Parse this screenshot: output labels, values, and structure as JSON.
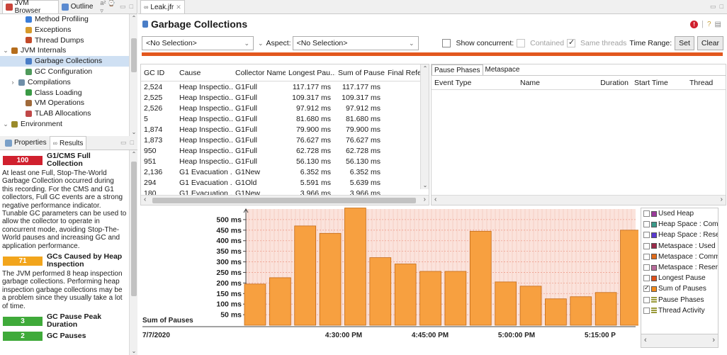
{
  "left_tabs": [
    {
      "label": "JVM Browser"
    },
    {
      "label": "Outline"
    }
  ],
  "tree": [
    {
      "label": "Method Profiling",
      "indent": 2,
      "icon_color": "#3b7dd8",
      "selected": false,
      "twisty": ""
    },
    {
      "label": "Exceptions",
      "indent": 2,
      "icon_color": "#d79a2b",
      "selected": false,
      "twisty": ""
    },
    {
      "label": "Thread Dumps",
      "indent": 2,
      "icon_color": "#c24a2a",
      "selected": false,
      "twisty": ""
    },
    {
      "label": "JVM Internals",
      "indent": 0,
      "icon_color": "#b56d1c",
      "selected": false,
      "twisty": "⌄"
    },
    {
      "label": "Garbage Collections",
      "indent": 2,
      "icon_color": "#4a7ec7",
      "selected": true,
      "twisty": ""
    },
    {
      "label": "GC Configuration",
      "indent": 2,
      "icon_color": "#4f9a5b",
      "selected": false,
      "twisty": ""
    },
    {
      "label": "Compilations",
      "indent": 1,
      "icon_color": "#6f8fa8",
      "selected": false,
      "twisty": "›"
    },
    {
      "label": "Class Loading",
      "indent": 2,
      "icon_color": "#3a9a45",
      "selected": false,
      "twisty": ""
    },
    {
      "label": "VM Operations",
      "indent": 2,
      "icon_color": "#a06a3a",
      "selected": false,
      "twisty": ""
    },
    {
      "label": "TLAB Allocations",
      "indent": 2,
      "icon_color": "#c04848",
      "selected": false,
      "twisty": ""
    },
    {
      "label": "Environment",
      "indent": 0,
      "icon_color": "#9a8a2a",
      "selected": false,
      "twisty": "⌄"
    }
  ],
  "results_tabs": [
    {
      "label": "Properties"
    },
    {
      "label": "Results"
    }
  ],
  "results": [
    {
      "score": "100",
      "score_color": "#d0202e",
      "title": "G1/CMS Full Collection",
      "text": "At least one Full, Stop-The-World Garbage Collection occurred during this recording. For the CMS and G1 collectors, Full GC events are a strong negative performance indicator. Tunable GC parameters can be used to allow the collector to operate in concurrent mode, avoiding Stop-The-World pauses and increasing GC and application performance."
    },
    {
      "score": "71",
      "score_color": "#f2a51c",
      "title": "GCs Caused by Heap Inspection",
      "text": "The JVM performed 8 heap inspection garbage collections. Performing heap inspection garbage collections may be a problem since they usually take a lot of time."
    },
    {
      "score": "3",
      "score_color": "#3faa3a",
      "title": "GC Pause Peak Duration",
      "text": ""
    },
    {
      "score": "2",
      "score_color": "#3faa3a",
      "title": "GC Pauses",
      "text": ""
    }
  ],
  "editor_tab": "Leak.jfr",
  "page_title": "Garbage Collections",
  "toolbar": {
    "selection_value": "<No Selection>",
    "aspect_label": "Aspect:",
    "aspect_value": "<No Selection>",
    "show_concurrent": "Show concurrent:",
    "contained": "Contained",
    "same_threads": "Same threads",
    "time_range": "Time Range:",
    "set": "Set",
    "clear": "Clear"
  },
  "gc_table": {
    "columns": [
      "GC ID",
      "Cause",
      "Collector Name",
      "Longest Pau...",
      "Sum of Pauses",
      "Final Refe"
    ],
    "rows": [
      [
        "2,524",
        "Heap Inspectio...",
        "G1Full",
        "117.177 ms",
        "117.177 ms",
        ""
      ],
      [
        "2,525",
        "Heap Inspectio...",
        "G1Full",
        "109.317 ms",
        "109.317 ms",
        ""
      ],
      [
        "2,526",
        "Heap Inspectio...",
        "G1Full",
        "97.912 ms",
        "97.912 ms",
        ""
      ],
      [
        "5",
        "Heap Inspectio...",
        "G1Full",
        "81.680 ms",
        "81.680 ms",
        ""
      ],
      [
        "1,874",
        "Heap Inspectio...",
        "G1Full",
        "79.900 ms",
        "79.900 ms",
        ""
      ],
      [
        "1,873",
        "Heap Inspectio...",
        "G1Full",
        "76.627 ms",
        "76.627 ms",
        ""
      ],
      [
        "950",
        "Heap Inspectio...",
        "G1Full",
        "62.728 ms",
        "62.728 ms",
        ""
      ],
      [
        "951",
        "Heap Inspectio...",
        "G1Full",
        "56.130 ms",
        "56.130 ms",
        ""
      ],
      [
        "2,136",
        "G1 Evacuation ...",
        "G1New",
        "6.352 ms",
        "6.352 ms",
        ""
      ],
      [
        "294",
        "G1 Evacuation ...",
        "G1Old",
        "5.591 ms",
        "5.639 ms",
        ""
      ],
      [
        "180",
        "G1 Evacuation ...",
        "G1New",
        "3.966 ms",
        "3.966 ms",
        ""
      ]
    ]
  },
  "pause_panel": {
    "tabs": [
      "Pause Phases",
      "Metaspace"
    ],
    "columns": [
      "Event Type",
      "Name",
      "Duration",
      "Start Time",
      "Thread"
    ]
  },
  "chart_data": {
    "type": "bar",
    "ylabel": "Sum of Pauses",
    "yticks": [
      "50 ms",
      "100 ms",
      "150 ms",
      "200 ms",
      "250 ms",
      "300 ms",
      "350 ms",
      "400 ms",
      "450 ms",
      "500 ms"
    ],
    "ylim": [
      0,
      550
    ],
    "xticks": [
      "4:30:00 PM",
      "4:45:00 PM",
      "5:00:00 PM",
      "5:15:00 P"
    ],
    "start_label": "7/7/2020",
    "values": [
      195,
      225,
      470,
      435,
      555,
      320,
      290,
      255,
      255,
      445,
      205,
      185,
      125,
      135,
      155,
      450
    ],
    "bar_color": "#f7a040",
    "grid": true
  },
  "legend": [
    {
      "label": "Used Heap",
      "color": "#9b3a9b",
      "checked": false,
      "kind": "box"
    },
    {
      "label": "Heap Space : Commi",
      "color": "#3a9a8a",
      "checked": false,
      "kind": "box"
    },
    {
      "label": "Heap Space : Reserve",
      "color": "#5a3ad0",
      "checked": false,
      "kind": "box"
    },
    {
      "label": "Metaspace : Used",
      "color": "#9a2a4a",
      "checked": false,
      "kind": "box"
    },
    {
      "label": "Metaspace : Commit",
      "color": "#e06a1a",
      "checked": false,
      "kind": "box"
    },
    {
      "label": "Metaspace : Reservec",
      "color": "#b86a9a",
      "checked": false,
      "kind": "box"
    },
    {
      "label": "Longest Pause",
      "color": "#e0501a",
      "checked": false,
      "kind": "box"
    },
    {
      "label": "Sum of Pauses",
      "color": "#f28a1a",
      "checked": true,
      "kind": "box"
    },
    {
      "label": "Pause Phases",
      "color": "#9a9a3a",
      "checked": false,
      "kind": "bars"
    },
    {
      "label": "Thread Activity",
      "color": "#9a9a3a",
      "checked": false,
      "kind": "bars"
    }
  ]
}
